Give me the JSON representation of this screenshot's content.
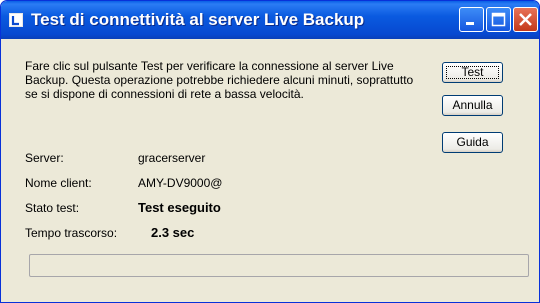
{
  "window": {
    "title": "Test di connettività al server Live Backup",
    "title_bar_color": "#0a5ae0",
    "icon": "live-backup-app-icon"
  },
  "title_buttons": {
    "minimize_icon": "minimize-icon",
    "maximize_icon": "maximize-icon",
    "close_icon": "close-icon"
  },
  "content": {
    "description": "Fare clic sul pulsante Test per verificare la connessione al server Live Backup.  Questa operazione potrebbe richiedere alcuni minuti, soprattutto se si dispone di connessioni di rete a bassa velocità."
  },
  "buttons": {
    "test": "Test",
    "annulla": "Annulla",
    "guida": "Guida"
  },
  "fields": {
    "server_label": "Server:",
    "server_value": "gracerserver",
    "client_label": "Nome client:",
    "client_value": "AMY-DV9000@",
    "status_label": "Stato test:",
    "status_value": "Test eseguito",
    "elapsed_label": "Tempo trascorso:",
    "elapsed_value": "2.3 sec"
  },
  "progress": {
    "fraction": 0
  }
}
